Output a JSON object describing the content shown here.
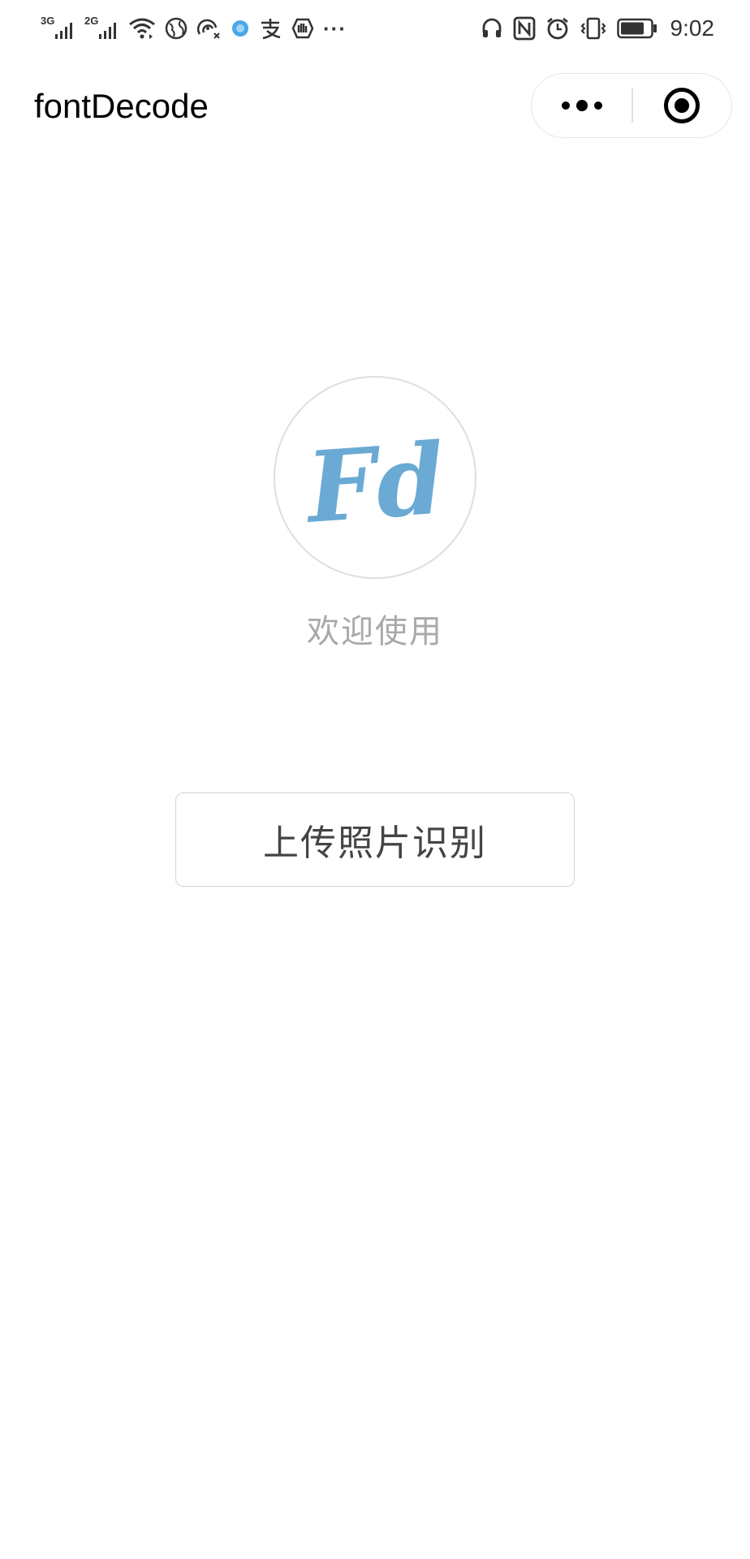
{
  "status_bar": {
    "signal_1_label": "3G",
    "signal_2_label": "2G",
    "overflow": "···",
    "time": "9:02",
    "icons_left": [
      "signal-3g-icon",
      "signal-2g-icon",
      "wifi-icon",
      "globe-icon",
      "hotspot-icon",
      "app-notification-icon",
      "alipay-icon",
      "shield-icon",
      "more-notifications-icon"
    ],
    "icons_right": [
      "headphones-icon",
      "nfc-icon",
      "alarm-icon",
      "vibrate-icon",
      "battery-icon"
    ]
  },
  "nav": {
    "title": "fontDecode",
    "capsule": {
      "more_icon": "more-dots-icon",
      "close_icon": "target-close-icon"
    }
  },
  "main": {
    "logo_text": "Fd",
    "logo_color": "#6aaad4",
    "welcome_text": "欢迎使用",
    "upload_button_label": "上传照片识别"
  }
}
